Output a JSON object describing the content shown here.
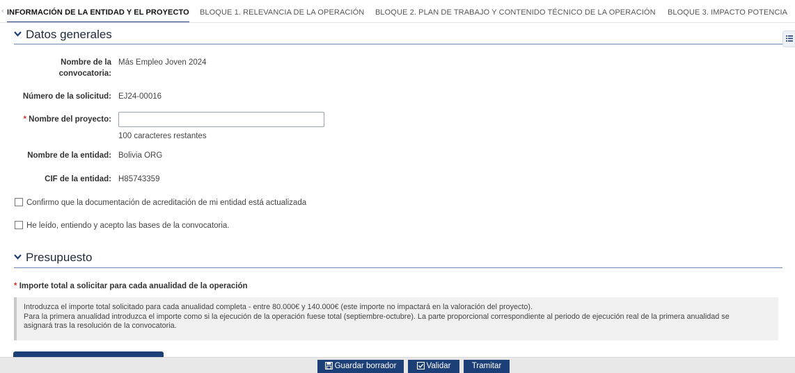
{
  "tabs": [
    {
      "label": "INFORMACIÓN DE LA ENTIDAD Y EL PROYECTO",
      "active": true
    },
    {
      "label": "BLOQUE 1. RELEVANCIA DE LA OPERACIÓN",
      "active": false
    },
    {
      "label": "BLOQUE 2. PLAN DE TRABAJO Y CONTENIDO TÉCNICO DE LA OPERACIÓN",
      "active": false
    },
    {
      "label": "BLOQUE 3. IMPACTO POTENCIA",
      "active": false
    }
  ],
  "datos_generales": {
    "title": "Datos generales",
    "convocatoria_label_line1": "Nombre de la",
    "convocatoria_label_line2": "convocatoria:",
    "convocatoria_value": "Más Empleo Joven 2024",
    "solicitud_label": "Número de la solicitud:",
    "solicitud_value": "EJ24-00016",
    "proyecto_required": "*",
    "proyecto_label": "Nombre del proyecto:",
    "proyecto_value": "",
    "proyecto_counter": "100 caracteres restantes",
    "entidad_label": "Nombre de la entidad:",
    "entidad_value": "Bolivia ORG",
    "cif_label": "CIF de la entidad:",
    "cif_value": "H85743359",
    "check1_label": "Confirmo que la documentación de acreditación de mi entidad está actualizada",
    "check2_label": "He leído, entiendo y acepto las bases de la convocatoria."
  },
  "presupuesto": {
    "title": "Presupuesto",
    "importe_required": "*",
    "importe_label": "Importe total a solicitar para cada anualidad de la operación",
    "info_line1": "Introduzca el importe total solicitado para cada anualidad completa - entre 80.000€ y 140.000€ (este importe no impactará en la valoración del proyecto).",
    "info_line2": "Para la primera anualidad introduzca el importe como si la ejecución de la operación fuese total (septiembre-octubre). La parte proporcional correspondiente al periodo de ejecución real de la primera anualidad se",
    "info_line3": "asignará tras la resolución de la convocatoria."
  },
  "footer": {
    "guardar_label": "Guardar borrador",
    "validar_label": "Validar",
    "tramitar_label": "Tramitar"
  },
  "icons": {
    "side_panel": "list-icon",
    "guardar": "save-icon",
    "validar": "check-square-icon",
    "section_toggle": "chevron-down-icon"
  },
  "colors": {
    "primary": "#1c3f78",
    "required": "#d0302b",
    "section_line": "#6a86b3"
  }
}
